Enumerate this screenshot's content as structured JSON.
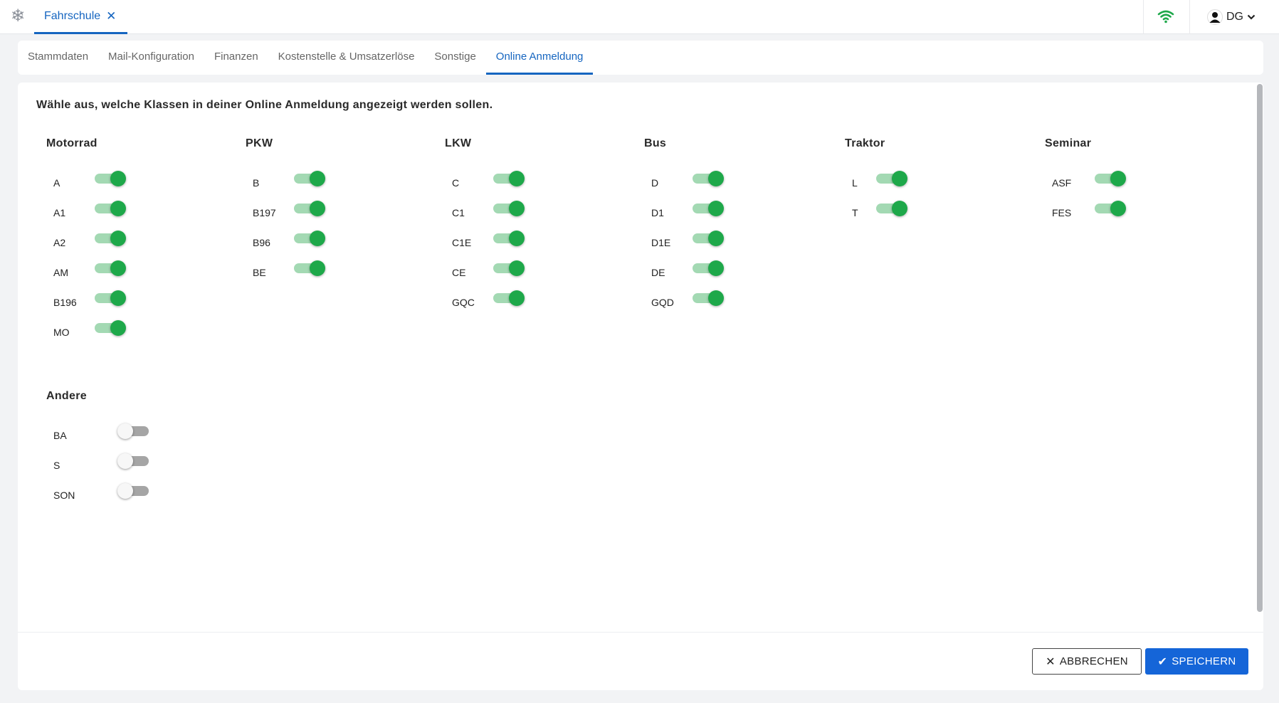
{
  "app": {
    "icon": "snowflake-icon",
    "tab_label": "Fahrschule"
  },
  "user": {
    "initials": "DG"
  },
  "tabs": [
    {
      "label": "Stammdaten",
      "active": false
    },
    {
      "label": "Mail-Konfiguration",
      "active": false
    },
    {
      "label": "Finanzen",
      "active": false
    },
    {
      "label": "Kostenstelle & Umsatzerlöse",
      "active": false
    },
    {
      "label": "Sonstige",
      "active": false
    },
    {
      "label": "Online Anmeldung",
      "active": true
    }
  ],
  "intro": "Wähle aus, welche Klassen in deiner Online Anmeldung angezeigt werden sollen.",
  "groups": [
    {
      "title": "Motorrad",
      "items": [
        {
          "label": "A",
          "on": true
        },
        {
          "label": "A1",
          "on": true
        },
        {
          "label": "A2",
          "on": true
        },
        {
          "label": "AM",
          "on": true
        },
        {
          "label": "B196",
          "on": true
        },
        {
          "label": "MO",
          "on": true
        }
      ]
    },
    {
      "title": "PKW",
      "items": [
        {
          "label": "B",
          "on": true
        },
        {
          "label": "B197",
          "on": true
        },
        {
          "label": "B96",
          "on": true
        },
        {
          "label": "BE",
          "on": true
        }
      ]
    },
    {
      "title": "LKW",
      "items": [
        {
          "label": "C",
          "on": true
        },
        {
          "label": "C1",
          "on": true
        },
        {
          "label": "C1E",
          "on": true
        },
        {
          "label": "CE",
          "on": true
        },
        {
          "label": "GQC",
          "on": true
        }
      ]
    },
    {
      "title": "Bus",
      "items": [
        {
          "label": "D",
          "on": true
        },
        {
          "label": "D1",
          "on": true
        },
        {
          "label": "D1E",
          "on": true
        },
        {
          "label": "DE",
          "on": true
        },
        {
          "label": "GQD",
          "on": true
        }
      ]
    },
    {
      "title": "Traktor",
      "items": [
        {
          "label": "L",
          "on": true
        },
        {
          "label": "T",
          "on": true
        }
      ]
    },
    {
      "title": "Seminar",
      "items": [
        {
          "label": "ASF",
          "on": true
        },
        {
          "label": "FES",
          "on": true
        }
      ]
    },
    {
      "title": "Andere",
      "items": [
        {
          "label": "BA",
          "on": false
        },
        {
          "label": "S",
          "on": false
        },
        {
          "label": "SON",
          "on": false
        }
      ]
    }
  ],
  "buttons": {
    "cancel": "ABBRECHEN",
    "save": "SPEICHERN"
  },
  "colors": {
    "accent": "#1565c0",
    "toggle_on": "#1ea84a",
    "toggle_off": "#a5a5a5"
  }
}
